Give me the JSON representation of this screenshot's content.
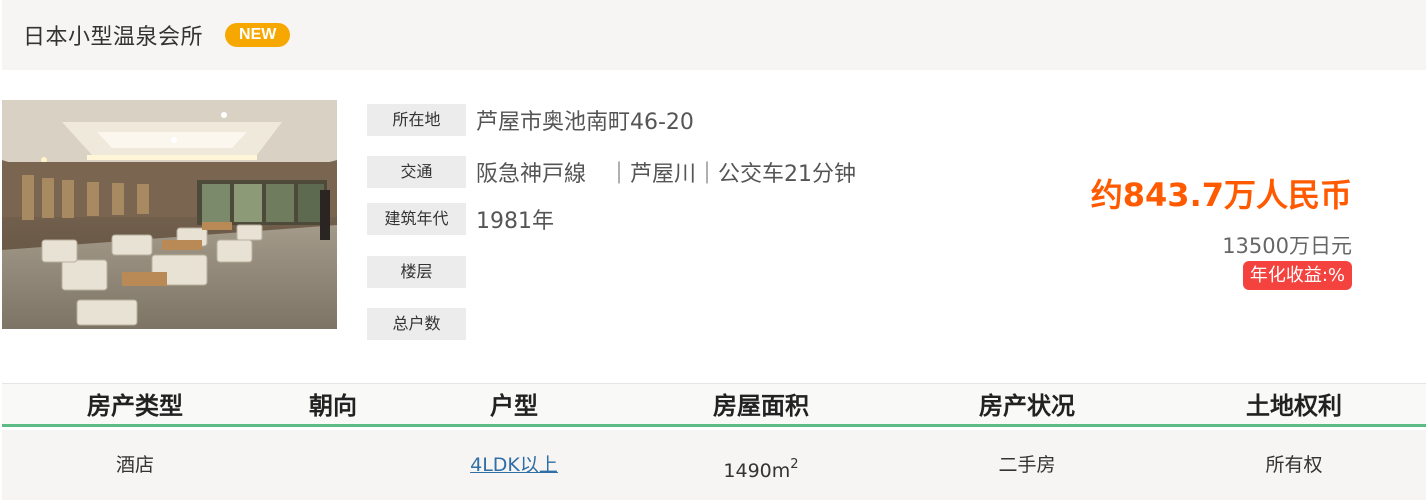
{
  "header": {
    "title": "日本小型温泉会所",
    "badge": "NEW"
  },
  "photo": {
    "alt": "室内大厅"
  },
  "info": {
    "location_label": "所在地",
    "location_value": "芦屋市奥池南町46-20",
    "transport_label": "交通",
    "transport_value": "阪急神戸線　｜芦屋川｜公交车21分钟",
    "built_label": "建筑年代",
    "built_value": "1981年",
    "floor_label": "楼层",
    "floor_value": "",
    "units_label": "总户数",
    "units_value": ""
  },
  "price": {
    "rmb": "约843.7万人民币",
    "jpy": "13500万日元",
    "yield": "年化收益:%"
  },
  "table": {
    "headers": [
      "房产类型",
      "朝向",
      "户型",
      "房屋面积",
      "房产状况",
      "土地权利"
    ],
    "type": "酒店",
    "orientation": "",
    "layout": "4LDK以上",
    "area_value": "1490m",
    "area_sup": "2",
    "condition": "二手房",
    "rights": "所有权"
  },
  "colors": {
    "accent": "#ff5a00",
    "badge": "#f6a800",
    "yield_badge": "#f4433f",
    "divider": "#5dbb86",
    "link": "#2f6fa6"
  }
}
